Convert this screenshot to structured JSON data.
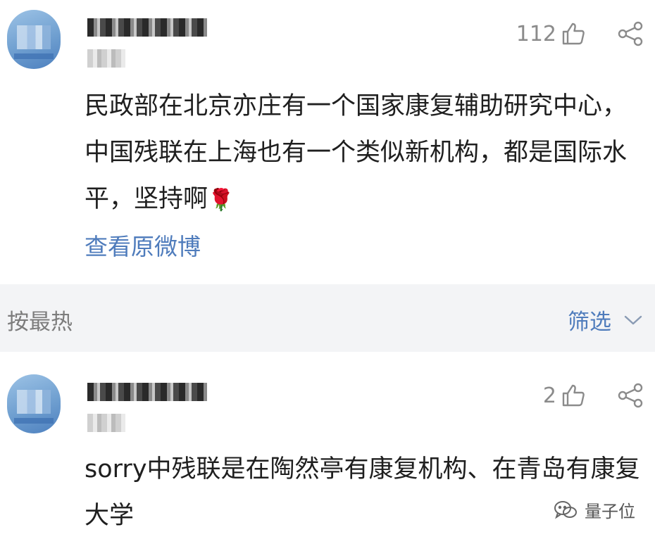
{
  "comments": [
    {
      "likes": "112",
      "text": "民政部在北京亦庄有一个国家康复辅助研究中心，中国残联在上海也有一个类似新机构，都是国际水平，坚持啊",
      "emoji": "🌹",
      "view_original": "查看原微博"
    },
    {
      "likes": "2",
      "text": "sorry中残联是在陶然亭有康复机构、在青岛有康复大学"
    }
  ],
  "sort_bar": {
    "sort_label": "按最热",
    "filter_label": "筛选"
  },
  "watermark": {
    "label": "量子位"
  },
  "icons": {
    "like": "thumbs-up-icon",
    "share": "share-icon",
    "filter_chevron": "chevron-down-icon",
    "watermark": "wechat-icon"
  }
}
